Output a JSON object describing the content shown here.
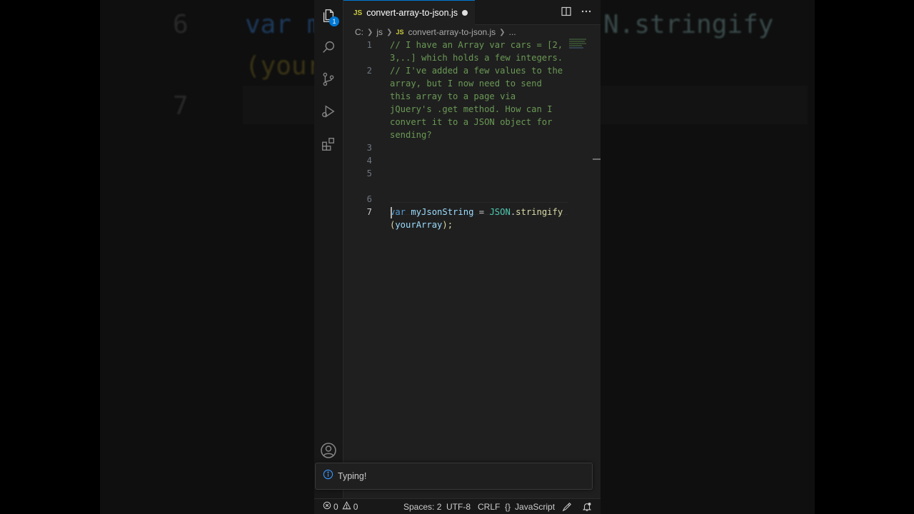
{
  "background": {
    "line6_num": "6",
    "line6_left": "var m",
    "line6_right": "N.stringify",
    "line6_cont": "(your",
    "line7_num": "7"
  },
  "tab": {
    "lang_badge": "JS",
    "title": "convert-array-to-json.js"
  },
  "activity": {
    "explorer_badge": "1"
  },
  "breadcrumb": {
    "drive": "C:",
    "folder": "js",
    "file_badge": "JS",
    "file": "convert-array-to-json.js",
    "more": "..."
  },
  "editor": {
    "lines": [
      {
        "num": "1",
        "text": "// I have an Array var cars = [2,"
      },
      {
        "num": "",
        "text": "3,..] which holds a few integers."
      },
      {
        "num": "2",
        "text": "// I've added a few values to the"
      },
      {
        "num": "",
        "text": "array, but I now need to send"
      },
      {
        "num": "",
        "text": "this array to a page via"
      },
      {
        "num": "",
        "text": "jQuery's .get method. How can I"
      },
      {
        "num": "",
        "text": "convert it to a JSON object for"
      },
      {
        "num": "",
        "text": "sending?"
      },
      {
        "num": "3",
        "text": ""
      },
      {
        "num": "4",
        "text": ""
      },
      {
        "num": "5",
        "text": ""
      },
      {
        "num": "6",
        "text": ""
      },
      {
        "num": "",
        "text": ""
      },
      {
        "num": "7",
        "text": ""
      }
    ],
    "line6_tokens": {
      "kw": "var",
      "name": "myJsonString",
      "eq": "=",
      "obj": "JSON",
      "dot": ".",
      "method": "stringify"
    },
    "line6_cont_tokens": {
      "open": "(",
      "arg": "yourArray",
      "close": ");"
    }
  },
  "notification": {
    "message": "Typing!"
  },
  "statusbar": {
    "errors": "0",
    "warnings": "0",
    "spaces": "Spaces: 2",
    "encoding": "UTF-8",
    "eol": "CRLF",
    "language": "JavaScript",
    "lang_braces": "{}"
  },
  "colors": {
    "accent": "#0078d4",
    "comment": "#6a9955",
    "keyword": "#569cd6",
    "variable": "#9cdcfe",
    "class": "#4ec9b0",
    "function": "#dcdcaa"
  },
  "icons": [
    "files-icon",
    "search-icon",
    "source-control-icon",
    "run-debug-icon",
    "extensions-icon",
    "account-icon",
    "split-editor-icon",
    "more-actions-icon",
    "info-icon",
    "error-icon",
    "warning-icon",
    "feedback-icon",
    "bell-icon"
  ]
}
